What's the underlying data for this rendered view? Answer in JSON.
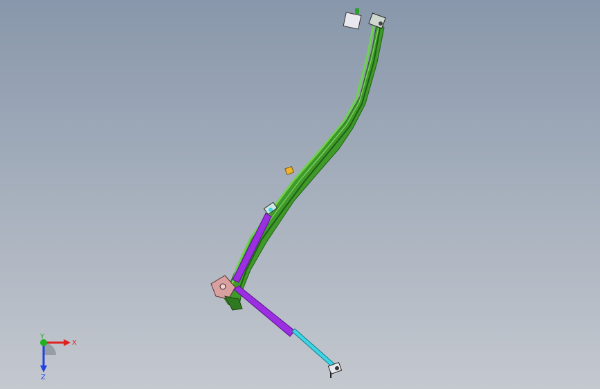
{
  "viewport": {
    "background_top": "#8897ab",
    "background_bottom": "#c4c8cf"
  },
  "model": {
    "rail_color": "#3f9a2a",
    "rail_dark": "#1f5f16",
    "rail_light": "#6fd24c",
    "cylinder_color": "#9b2ee0",
    "rod_color": "#3ad6e6",
    "bracket_color": "#d9a0a0",
    "block_color": "#f0b428"
  },
  "triad": {
    "x_label": "X",
    "y_label": "Y",
    "z_label": "Z",
    "x_color": "#e02020",
    "y_color": "#20b020",
    "z_color": "#2040e0"
  }
}
